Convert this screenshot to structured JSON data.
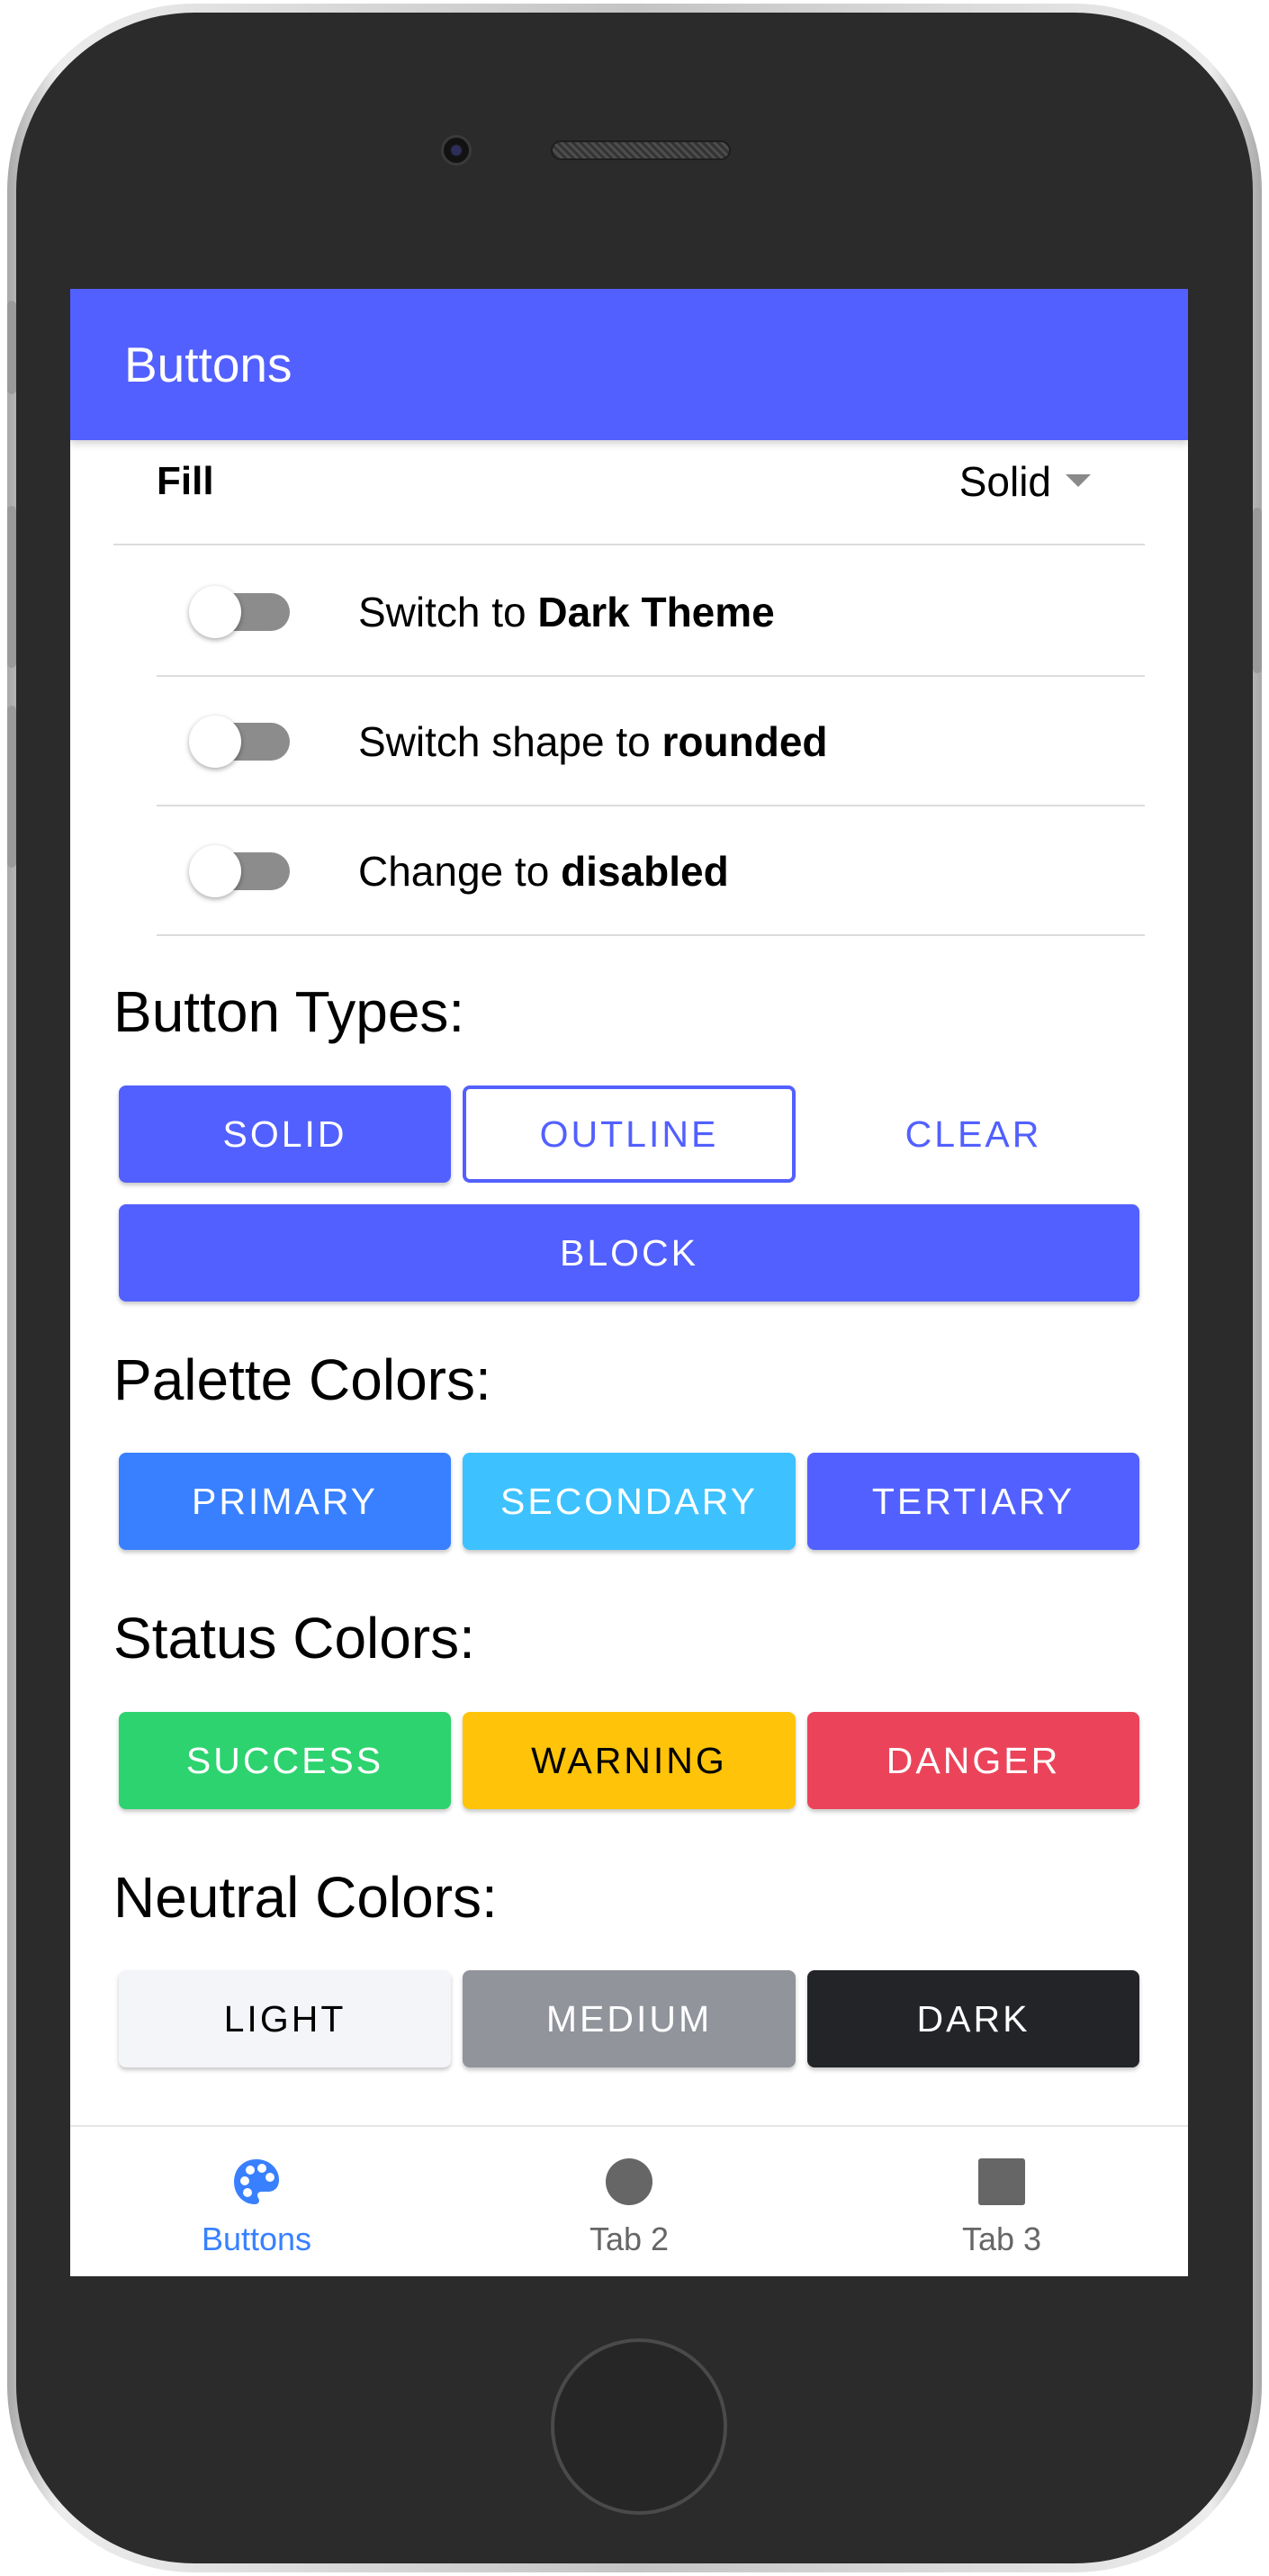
{
  "toolbar": {
    "title": "Buttons"
  },
  "fill": {
    "label": "Fill",
    "value": "Solid"
  },
  "toggles": [
    {
      "prefix": "Switch to ",
      "emphasis": "Dark Theme",
      "checked": false
    },
    {
      "prefix": "Switch shape to ",
      "emphasis": "rounded",
      "checked": false
    },
    {
      "prefix": "Change to ",
      "emphasis": "disabled",
      "checked": false
    }
  ],
  "sections": {
    "button_types": "Button Types:",
    "palette_colors": "Palette Colors:",
    "status_colors": "Status Colors:",
    "neutral_colors": "Neutral Colors:"
  },
  "button_types": {
    "solid": "SOLID",
    "outline": "OUTLINE",
    "clear": "CLEAR",
    "block": "BLOCK"
  },
  "palette": {
    "primary": "PRIMARY",
    "secondary": "SECONDARY",
    "tertiary": "TERTIARY"
  },
  "status": {
    "success": "SUCCESS",
    "warning": "WARNING",
    "danger": "DANGER"
  },
  "neutral": {
    "light": "LIGHT",
    "medium": "MEDIUM",
    "dark": "DARK"
  },
  "tabs": [
    {
      "label": "Buttons",
      "icon": "palette-icon",
      "selected": true
    },
    {
      "label": "Tab 2",
      "icon": "circle-icon",
      "selected": false
    },
    {
      "label": "Tab 3",
      "icon": "square-icon",
      "selected": false
    }
  ],
  "colors": {
    "toolbar": "#5260ff",
    "primary": "#3880ff",
    "secondary": "#3dc2ff",
    "tertiary": "#5260ff",
    "success": "#2dd36f",
    "warning": "#ffc409",
    "danger": "#eb445a",
    "light": "#f4f5f8",
    "medium": "#92949c",
    "dark": "#222428",
    "tab_selected": "#3880ff",
    "tab_unselected": "#666666"
  }
}
